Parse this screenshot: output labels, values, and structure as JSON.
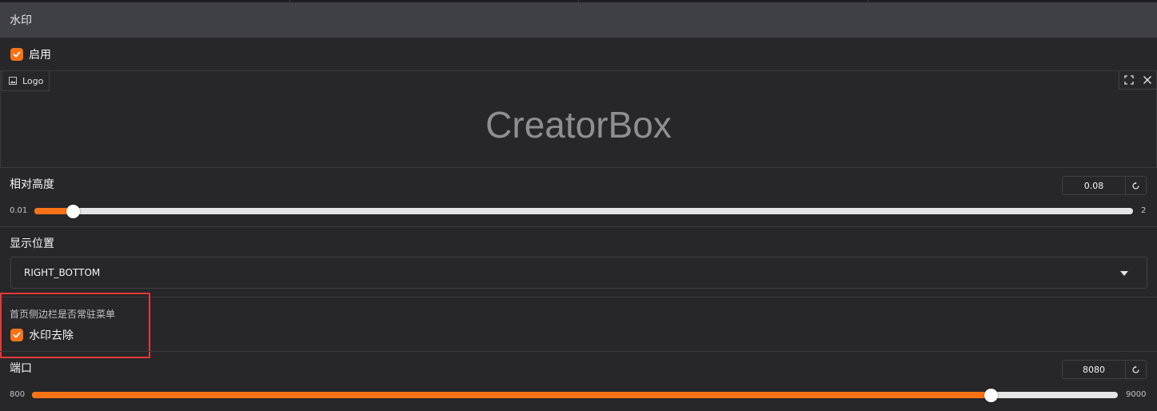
{
  "header": {
    "title": "水印"
  },
  "enable": {
    "label": "启用",
    "checked": true
  },
  "logo": {
    "tag_label": "Logo",
    "preview_text": "CreatorBox"
  },
  "relative_height": {
    "label": "相对高度",
    "value": "0.08",
    "min": "0.01",
    "max": "2",
    "fraction": 0.035
  },
  "position": {
    "label": "显示位置",
    "selected": "RIGHT_BOTTOM"
  },
  "sidebar_menu": {
    "label": "首页侧边栏是否常驻菜单"
  },
  "watermark_remove": {
    "label": "水印去除",
    "checked": true
  },
  "port": {
    "label": "端口",
    "value": "8080",
    "min": "800",
    "max": "9000",
    "fraction": 0.8829
  },
  "colors": {
    "accent": "#f97316",
    "highlight": "#e53935",
    "background": "#27272a"
  }
}
